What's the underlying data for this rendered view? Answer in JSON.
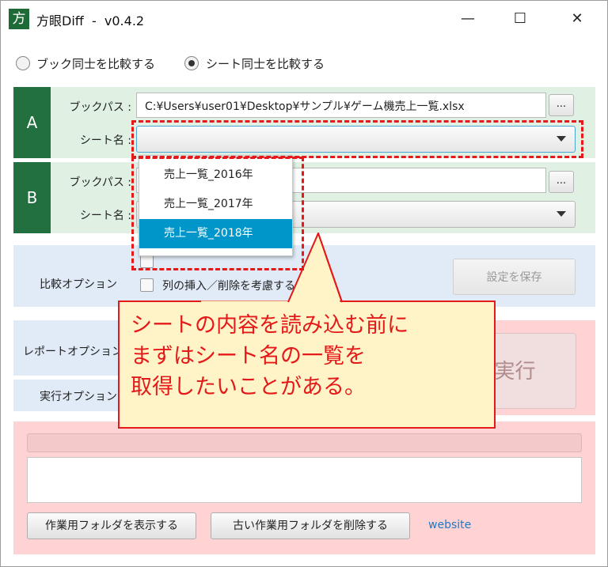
{
  "window": {
    "title": "方眼Diff  -  v0.4.2",
    "app_icon_glyph": "方",
    "minimize_glyph": "—",
    "maximize_glyph": "☐",
    "close_glyph": "✕"
  },
  "mode": {
    "option_books": "ブック同士を比較する",
    "option_sheets": "シート同士を比較する",
    "selected": "sheets"
  },
  "section_a": {
    "letter": "A",
    "book_path_label": "ブックパス :",
    "book_path_value": "C:¥Users¥user01¥Desktop¥サンプル¥ゲーム機売上一覧.xlsx",
    "browse_label": "...",
    "sheet_label": "シート名 :",
    "sheet_value": ""
  },
  "section_b": {
    "letter": "B",
    "book_path_label": "ブックパス :",
    "book_path_value": "",
    "browse_label": "...",
    "sheet_label": "シート名 :",
    "sheet_value": ""
  },
  "dropdown": {
    "items": [
      "売上一覧_2016年",
      "売上一覧_2017年",
      "売上一覧_2018年"
    ],
    "selected_index": 2
  },
  "compare_options": {
    "label": "比較オプション",
    "checkbox1_label": "る",
    "checkbox2_label": "列の挿入／削除を考慮する",
    "save_button": "設定を保存"
  },
  "report_options": {
    "label": "レポートオプション"
  },
  "run_options": {
    "label": "実行オプション"
  },
  "run_button": "実行",
  "footer": {
    "show_work_folder": "作業用フォルダを表示する",
    "delete_old_folders": "古い作業用フォルダを削除する",
    "website_link": "website"
  },
  "annotation": {
    "line1": "シートの内容を読み込む前に",
    "line2": "まずはシート名の一覧を",
    "line3": "取得したいことがある。"
  },
  "colors": {
    "accent_green": "#226f3f",
    "panel_green": "#e0f1e4",
    "panel_blue": "#e0ebf7",
    "panel_pink": "#ffd3d3",
    "highlight": "#0096c9",
    "annotation_red": "#e41919",
    "annotation_fill": "#fff4c7"
  }
}
